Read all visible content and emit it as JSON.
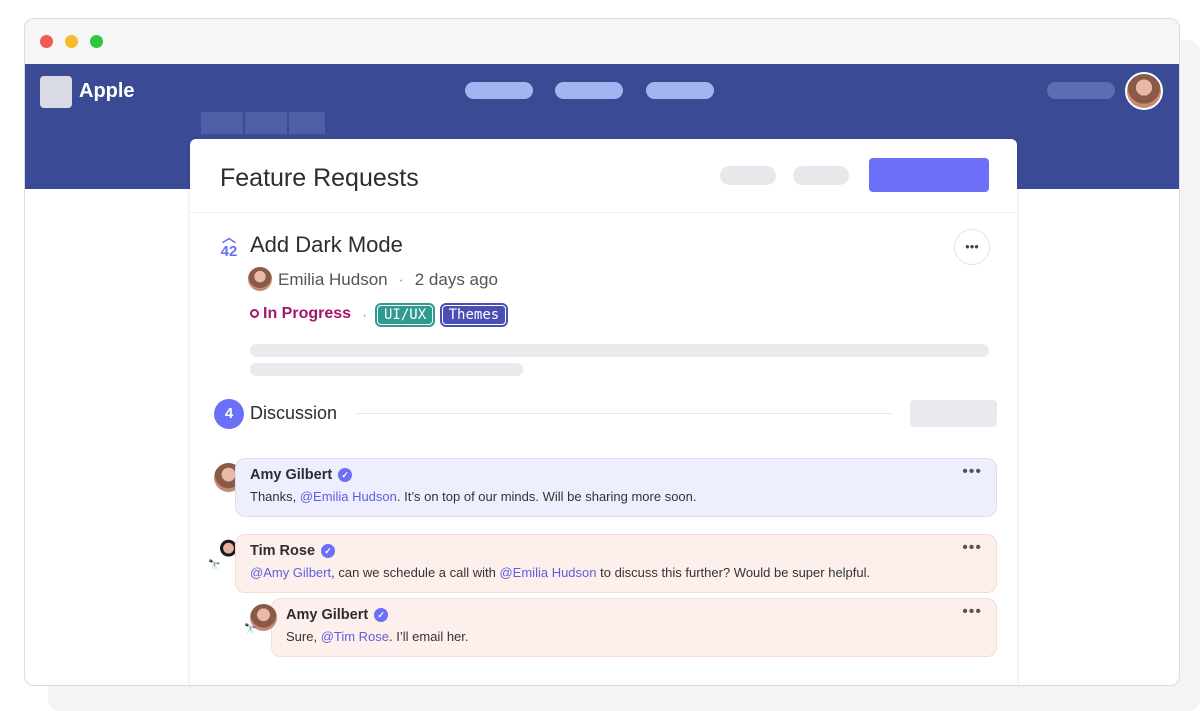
{
  "app": {
    "brand": "Apple",
    "logo_icon": "apple-icon"
  },
  "page": {
    "title": "Feature Requests"
  },
  "request": {
    "title": "Add Dark Mode",
    "votes": "42",
    "author": "Emilia Hudson",
    "separator": "·",
    "time": "2 days ago",
    "status": "In Progress",
    "tags": [
      "UI/UX",
      "Themes"
    ],
    "more": "•••"
  },
  "discussion": {
    "count": "4",
    "label": "Discussion"
  },
  "comments": [
    {
      "author": "Amy Gilbert",
      "parts": [
        "Thanks, ",
        "@Emilia Hudson",
        ". It’s on top of our minds. Will be sharing more soon."
      ]
    },
    {
      "author": "Tim Rose",
      "parts": [
        "@Amy Gilbert",
        ", can we schedule a call with ",
        "@Emilia Hudson",
        " to discuss this further? Would be super helpful."
      ]
    },
    {
      "author": "Amy Gilbert",
      "parts": [
        "Sure, ",
        "@Tim Rose",
        ". I’ll email her."
      ]
    }
  ],
  "colors": {
    "header": "#3a4a94",
    "accent": "#6c6ff7",
    "status": "#a3176b",
    "tag_uiux": "#2f9a8f",
    "tag_themes": "#4b4fb3"
  }
}
